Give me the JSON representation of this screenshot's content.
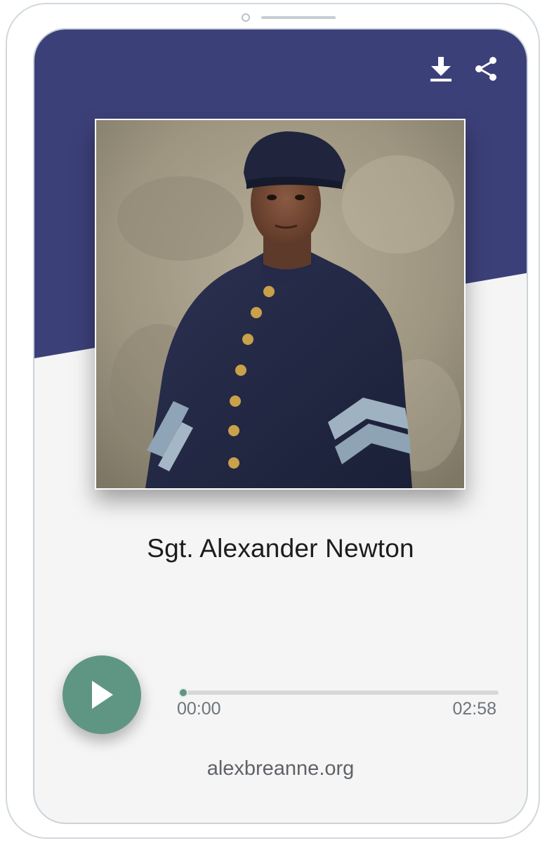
{
  "player": {
    "title": "Sgt. Alexander Newton",
    "current_time": "00:00",
    "duration": "02:58",
    "progress": 0.0,
    "footer_link": "alexbreanne.org"
  },
  "header": {
    "icons": [
      "download-icon",
      "share-icon"
    ]
  },
  "colors": {
    "header_bg": "#3c4079",
    "screen_bg": "#f5f5f5",
    "accent": "#5f9683",
    "track": "#d7d7d7",
    "title_text": "#1c1c1c",
    "muted_text": "#6c757d"
  },
  "icons": {
    "play": "play-icon",
    "download": "download-icon",
    "share": "share-icon"
  }
}
